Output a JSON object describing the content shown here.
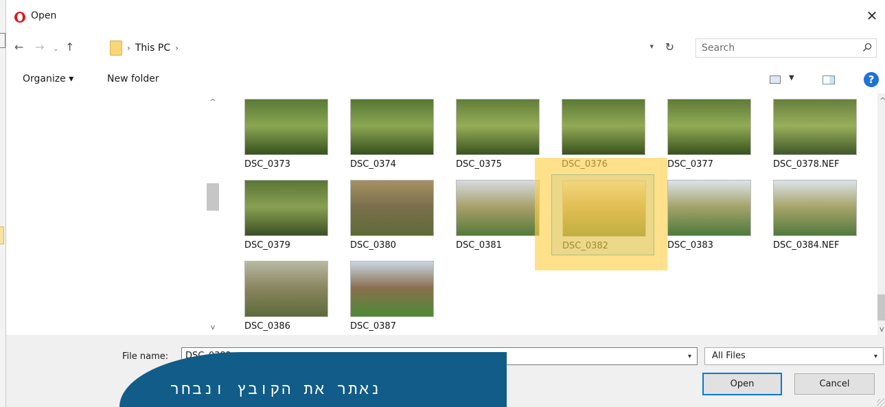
{
  "window": {
    "title": "Open"
  },
  "nav": {
    "path": [
      "This PC"
    ],
    "search_placeholder": "Search"
  },
  "toolbar": {
    "organize_label": "Organize",
    "new_folder_label": "New folder",
    "help_label": "?"
  },
  "files": [
    {
      "name": "DSC_0373",
      "selected": false,
      "colors": [
        "#5a7a34",
        "#8aa653",
        "#37521d"
      ]
    },
    {
      "name": "DSC_0374",
      "selected": false,
      "colors": [
        "#567734",
        "#8ca653",
        "#36501c"
      ]
    },
    {
      "name": "DSC_0375",
      "selected": false,
      "colors": [
        "#627d38",
        "#96ad58",
        "#3a531f"
      ]
    },
    {
      "name": "DSC_0376",
      "selected": false,
      "colors": [
        "#5b7936",
        "#92aa56",
        "#38521d"
      ]
    },
    {
      "name": "DSC_0377",
      "selected": false,
      "colors": [
        "#5f7b37",
        "#91ab55",
        "#38511d"
      ]
    },
    {
      "name": "DSC_0378.NEF",
      "selected": false,
      "colors": [
        "#667f3c",
        "#99af5b",
        "#40572a"
      ]
    },
    {
      "name": "DSC_0379",
      "selected": false,
      "colors": [
        "#5b7535",
        "#88a052",
        "#3d4f25"
      ]
    },
    {
      "name": "DSC_0380",
      "selected": false,
      "colors": [
        "#a59163",
        "#7a6f4c",
        "#5d6b35"
      ]
    },
    {
      "name": "DSC_0381",
      "selected": false,
      "colors": [
        "#d6dbdf",
        "#a8a06a",
        "#557a3a"
      ]
    },
    {
      "name": "DSC_0382",
      "selected": true,
      "colors": [
        "#dfe1d8",
        "#b0a46a",
        "#5b7c3b"
      ]
    },
    {
      "name": "DSC_0383",
      "selected": false,
      "colors": [
        "#dde3e8",
        "#a3a36a",
        "#4f7a3e"
      ]
    },
    {
      "name": "DSC_0384.NEF",
      "selected": false,
      "colors": [
        "#dde3e8",
        "#a7a46b",
        "#52793d"
      ]
    },
    {
      "name": "DSC_0386",
      "selected": false,
      "colors": [
        "#b7b9a3",
        "#8a8660",
        "#5d6a3a"
      ]
    },
    {
      "name": "DSC_0387",
      "selected": false,
      "colors": [
        "#c9d6e2",
        "#8a6f50",
        "#4e8a35"
      ]
    }
  ],
  "footer": {
    "file_name_label": "File name:",
    "file_name_value": "DSC_0382",
    "file_type": "All Files",
    "open_label": "Open",
    "cancel_label": "Cancel"
  },
  "overlay": {
    "callout_text": "נאתר את הקובץ ונבחר"
  },
  "colors": {
    "accent": "#0078d7",
    "callout_bg": "#115c88",
    "highlight": "#ffce46"
  }
}
